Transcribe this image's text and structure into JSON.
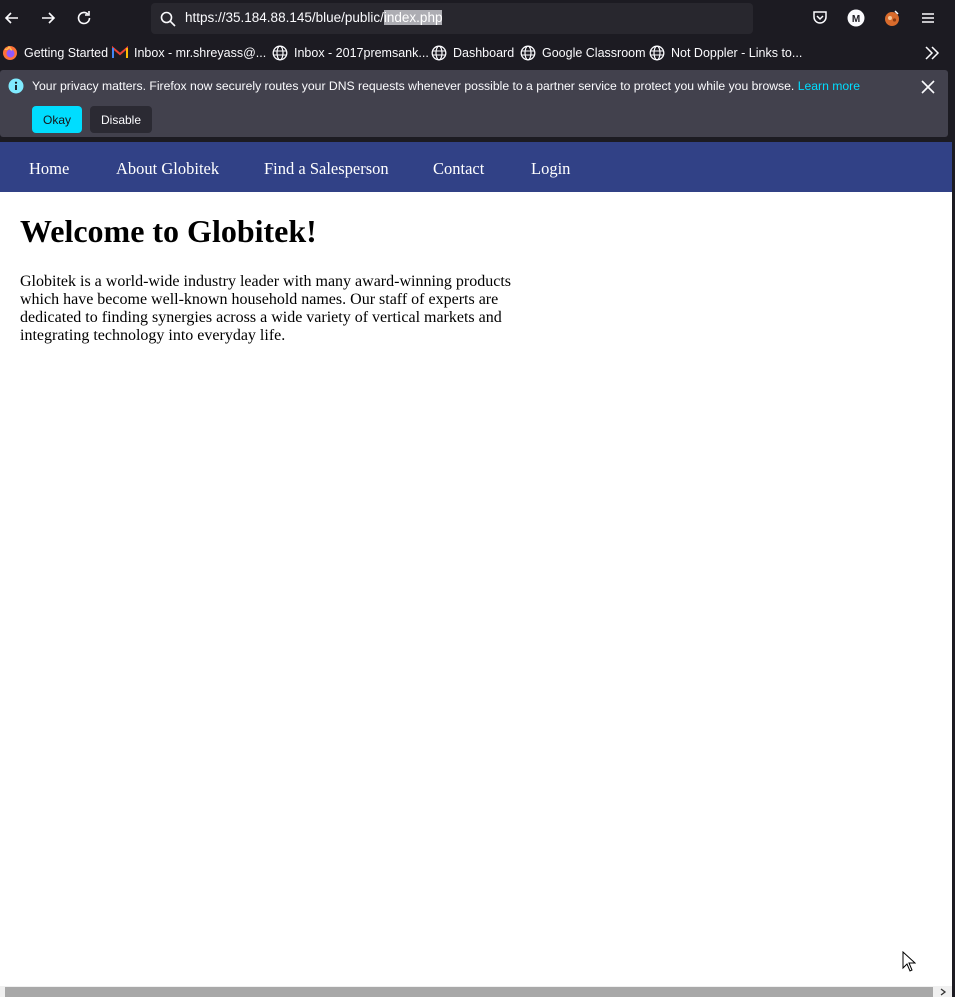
{
  "browser": {
    "url_main": "https://35.184.88.145/blue/public/",
    "url_selected": "index.php",
    "bookmarks": [
      {
        "label": "Getting Started",
        "icon": "firefox-icon"
      },
      {
        "label": "Inbox - mr.shreyass@...",
        "icon": "gmail-icon"
      },
      {
        "label": "Inbox - 2017premsank...",
        "icon": "globe-icon"
      },
      {
        "label": "Dashboard",
        "icon": "globe-icon"
      },
      {
        "label": "Google Classroom",
        "icon": "globe-icon"
      },
      {
        "label": "Not Doppler - Links to...",
        "icon": "globe-icon"
      }
    ],
    "account_initial": "M"
  },
  "notification": {
    "message": "Your privacy matters. Firefox now securely routes your DNS requests whenever possible to a partner service to protect you while you browse.",
    "link": "Learn more",
    "okay_label": "Okay",
    "disable_label": "Disable"
  },
  "site": {
    "nav": [
      "Home",
      "About Globitek",
      "Find a Salesperson",
      "Contact",
      "Login"
    ],
    "title": "Welcome to Globitek!",
    "body": "Globitek is a world-wide industry leader with many award-winning products which have become well-known household names. Our staff of experts are dedicated to finding synergies across a wide variety of vertical markets and integrating technology into everyday life."
  },
  "colors": {
    "nav_background": "#314186",
    "browser_chrome": "#1c1b22",
    "notification_background": "#42414d",
    "accent": "#00ddff"
  }
}
